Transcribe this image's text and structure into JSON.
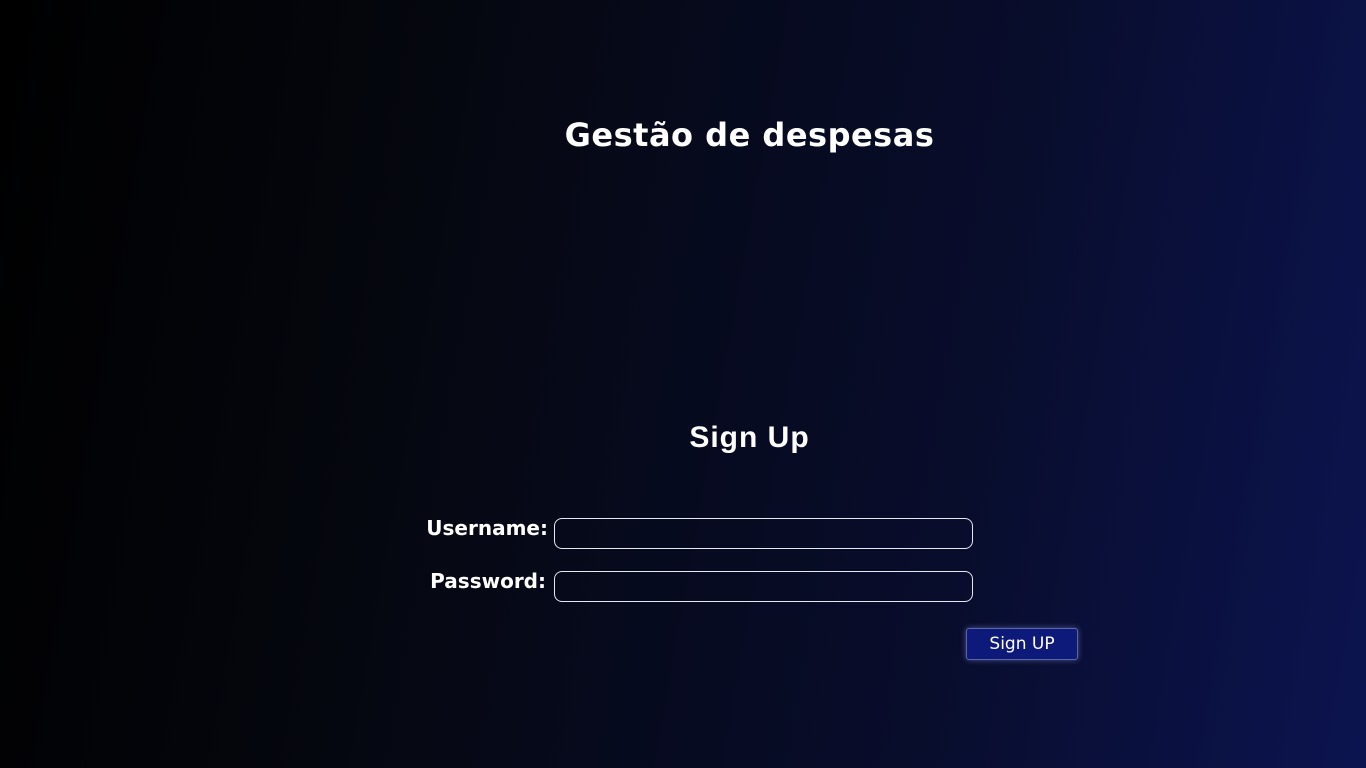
{
  "app": {
    "title": "Gestão de despesas"
  },
  "form": {
    "title": "Sign Up",
    "username_label": "Username:",
    "username_value": "",
    "password_label": "Password:",
    "password_value": "",
    "submit_label": "Sign UP"
  },
  "colors": {
    "background_start": "#000000",
    "background_end": "#0c1450",
    "button_bg": "#0d1a7a",
    "input_border": "#e8e8f0",
    "text": "#ffffff"
  }
}
